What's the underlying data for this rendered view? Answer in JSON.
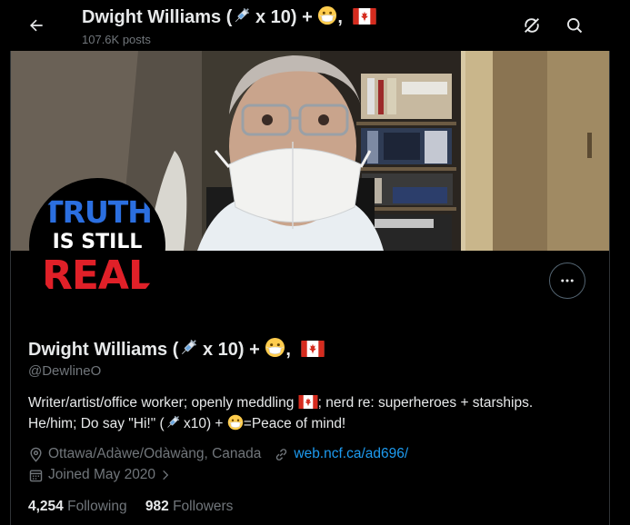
{
  "header": {
    "name_prefix": "Dwight Williams (",
    "name_x10": " x 10) + ",
    "name_suffix": ",",
    "posts": "107.6K posts"
  },
  "profile": {
    "name_prefix": "Dwight Williams (",
    "name_x10": " x 10) + ",
    "name_suffix": ",",
    "handle": "@DewlineO",
    "bio_line1_a": "Writer/artist/office worker; openly meddling ",
    "bio_line1_b": "; nerd re: superheroes + starships.",
    "bio_line2_a": "He/him; Do say \"Hi!\" (",
    "bio_line2_b": " x10) + ",
    "bio_line2_c": "=Peace of mind!",
    "location": "Ottawa/Adàwe/Odàwàng, Canada",
    "website": "web.ncf.ca/ad696/",
    "joined": "Joined May 2020",
    "following_count": "4,254",
    "following_label": "Following",
    "followers_count": "982",
    "followers_label": "Followers"
  },
  "avatar_text": {
    "line1": "TRUTH",
    "line2": "IS STILL",
    "line3": "REAL"
  },
  "icons": [
    "back-arrow-icon",
    "syringe-icon",
    "mask-emoji-icon",
    "canada-flag-icon",
    "retweet-slash-icon",
    "search-icon",
    "more-dots-icon",
    "location-pin-icon",
    "link-icon",
    "calendar-icon",
    "chevron-right-icon"
  ],
  "colors": {
    "background": "#000000",
    "text_primary": "#e7e9ea",
    "text_secondary": "#71767b",
    "link": "#1d9bf0",
    "flag_red": "#d52b1e"
  }
}
